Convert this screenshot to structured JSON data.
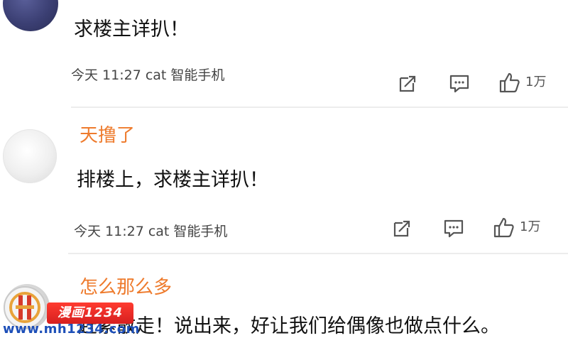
{
  "comments": [
    {
      "content": "求楼主详扒！",
      "time": "今天 11:27",
      "device": "cat 智能手机",
      "likes": "1万"
    },
    {
      "username": "天撸了",
      "content": "排楼上，求楼主详扒！",
      "time": "今天 11:27",
      "device": "cat 智能手机",
      "likes": "1万"
    },
    {
      "username": "怎么那么多",
      "content": "赶紧散走！说出来，好让我们给偶像也做点什么。"
    }
  ],
  "watermark": {
    "badge": "漫画1234",
    "url": "www.mh1234.com"
  },
  "colors": {
    "username": "#ee7b2d",
    "divider": "#ececec",
    "watermark_url": "#1d4fb8",
    "watermark_badge": "#d61f1f"
  },
  "icons": [
    "share-icon",
    "comment-icon",
    "like-icon"
  ]
}
